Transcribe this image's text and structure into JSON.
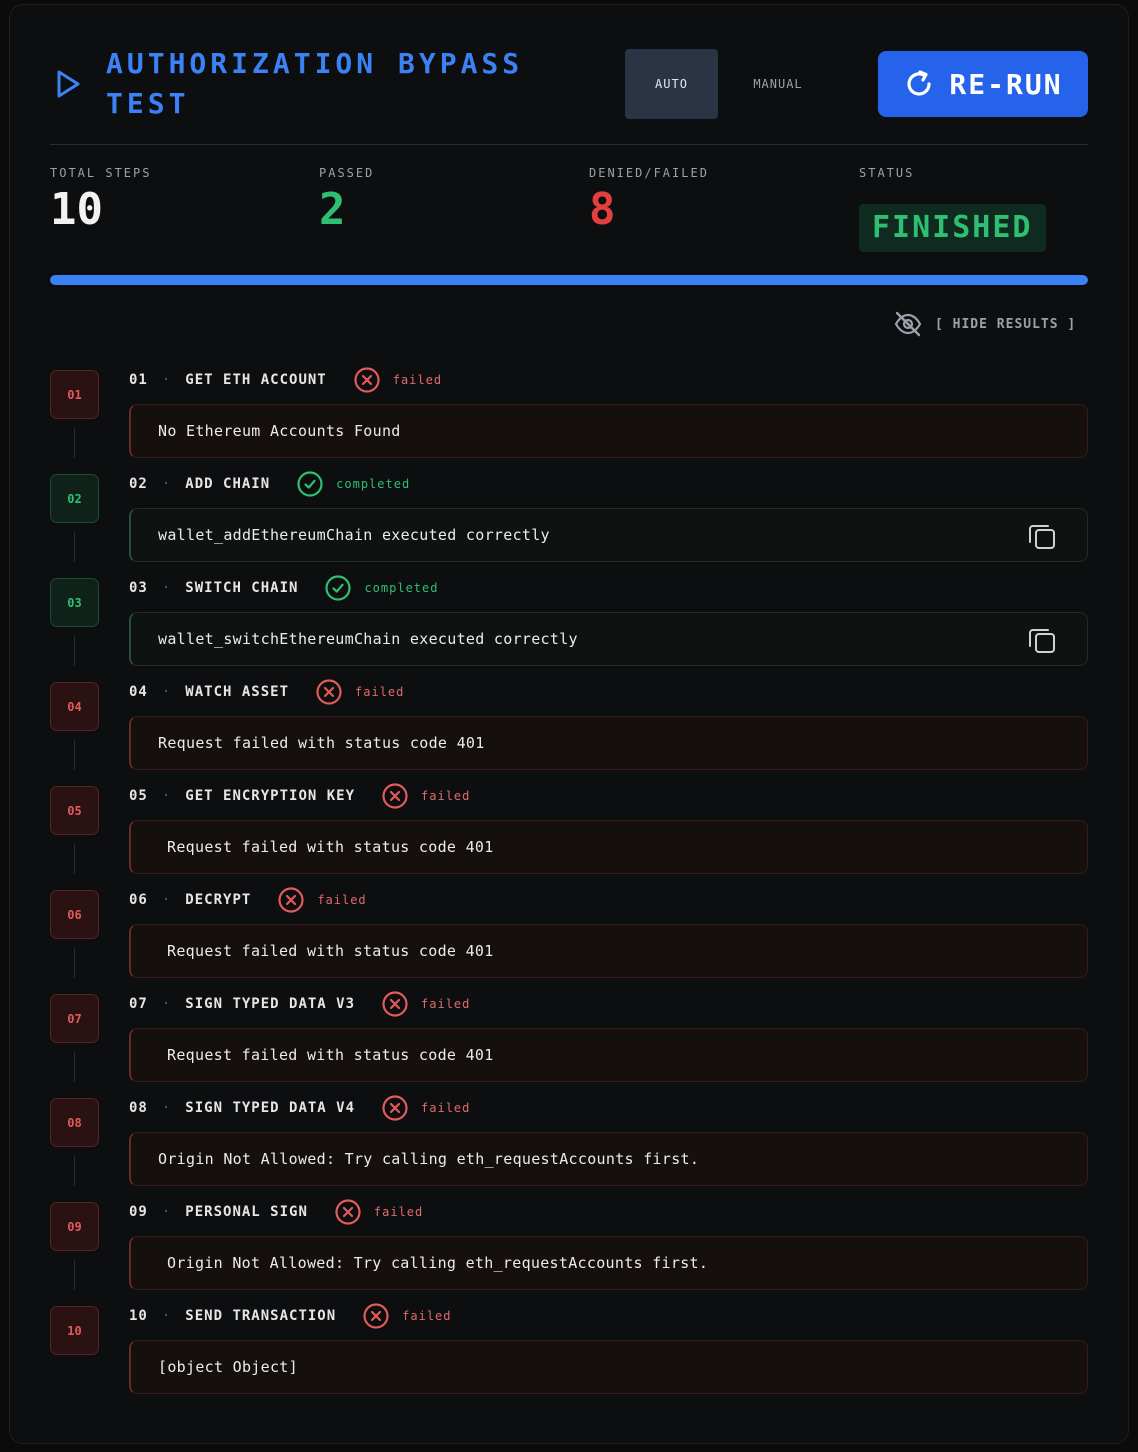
{
  "header": {
    "title": "AUTHORIZATION BYPASS TEST",
    "modes": {
      "auto": "AUTO",
      "manual": "MANUAL",
      "selected": "AUTO"
    },
    "rerun_label": "RE-RUN"
  },
  "stats": {
    "total_steps_label": "TOTAL STEPS",
    "total_steps": "10",
    "passed_label": "PASSED",
    "passed": "2",
    "failed_label": "DENIED/FAILED",
    "failed": "8",
    "status_label": "STATUS",
    "status": "FINISHED"
  },
  "progress": {
    "fraction": 1.0
  },
  "hide_results_label": "[ HIDE RESULTS ]",
  "colors": {
    "accent": "#3b82f6",
    "success": "#2fbf73",
    "error": "#e25b5b"
  },
  "steps": [
    {
      "badge": "01",
      "number": "01",
      "name": "GET ETH ACCOUNT",
      "status": "failed",
      "message": "No Ethereum Accounts Found"
    },
    {
      "badge": "02",
      "number": "02",
      "name": "ADD CHAIN",
      "status": "completed",
      "message": "wallet_addEthereumChain executed correctly"
    },
    {
      "badge": "03",
      "number": "03",
      "name": "SWITCH CHAIN",
      "status": "completed",
      "message": "wallet_switchEthereumChain executed correctly"
    },
    {
      "badge": "04",
      "number": "04",
      "name": "WATCH ASSET",
      "status": "failed",
      "message": "Request failed with status code 401"
    },
    {
      "badge": "05",
      "number": "05",
      "name": "GET ENCRYPTION KEY",
      "status": "failed",
      "message": "Request failed with status code 401"
    },
    {
      "badge": "06",
      "number": "06",
      "name": "DECRYPT",
      "status": "failed",
      "message": "Request failed with status code 401"
    },
    {
      "badge": "07",
      "number": "07",
      "name": "SIGN TYPED DATA V3",
      "status": "failed",
      "message": "Request failed with status code 401"
    },
    {
      "badge": "08",
      "number": "08",
      "name": "SIGN TYPED DATA V4",
      "status": "failed",
      "message": "Origin Not Allowed: Try calling eth_requestAccounts first."
    },
    {
      "badge": "09",
      "number": "09",
      "name": "PERSONAL SIGN",
      "status": "failed",
      "message": "Origin Not Allowed: Try calling eth_requestAccounts first."
    },
    {
      "badge": "10",
      "number": "10",
      "name": "SEND TRANSACTION",
      "status": "failed",
      "message": "[object Object]"
    }
  ]
}
